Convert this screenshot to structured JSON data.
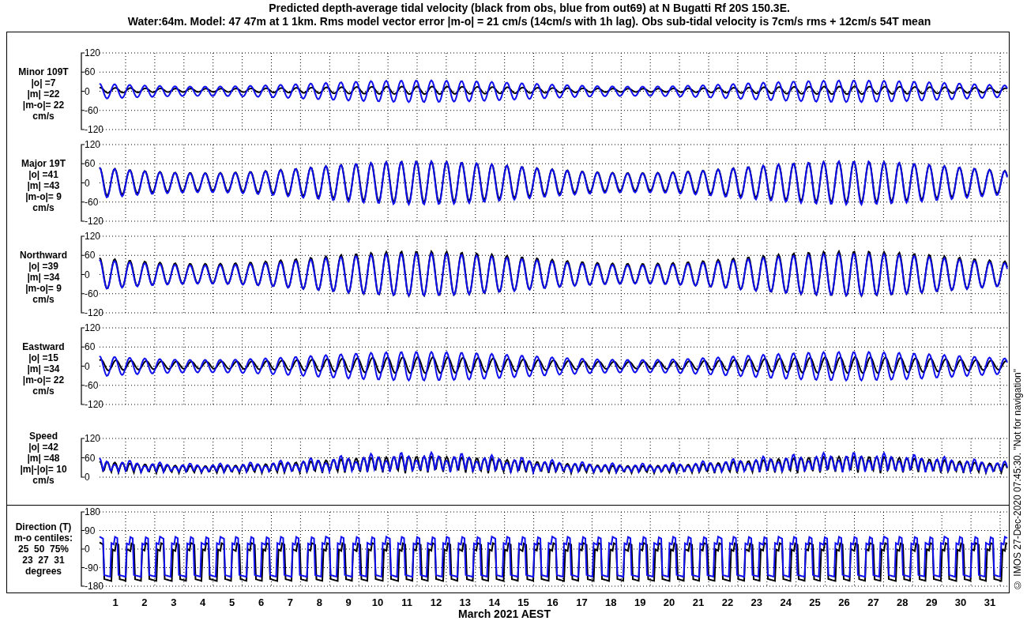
{
  "title_lines": [
    "Predicted depth-average tidal velocity (black from obs, blue from out69) at N Bugatti Rf 20S 150.3E.",
    "Water:64m. Model: 47 47m at 1 1km. Rms model vector error |m-o| = 21 cm/s (14cm/s with 1h lag). Obs sub-tidal velocity is 7cm/s rms + 12cm/s 54T mean"
  ],
  "panels": [
    {
      "kind": "velocity",
      "label_lines": [
        "Minor 109T",
        "|o| =7",
        "|m| =22",
        "|m-o|= 22",
        "cm/s"
      ],
      "yticks": [
        "120",
        "60",
        "0",
        "-60",
        "-120"
      ]
    },
    {
      "kind": "velocity",
      "label_lines": [
        "Major 19T",
        "|o| =41",
        "|m| =43",
        "|m-o|= 9",
        "cm/s"
      ],
      "yticks": [
        "120",
        "60",
        "0",
        "-60",
        "-120"
      ]
    },
    {
      "kind": "velocity",
      "label_lines": [
        "Northward",
        "|o| =39",
        "|m| =34",
        "|m-o|= 9",
        "cm/s"
      ],
      "yticks": [
        "120",
        "60",
        "0",
        "-60",
        "-120"
      ]
    },
    {
      "kind": "velocity",
      "label_lines": [
        "Eastward",
        "|o| =15",
        "|m| =34",
        "|m-o|= 22",
        "cm/s"
      ],
      "yticks": [
        "120",
        "60",
        "0",
        "-60",
        "-120"
      ]
    },
    {
      "kind": "speed",
      "label_lines": [
        "Speed",
        "|o| =42",
        "|m| =48",
        "|m|-|o|= 10",
        "cm/s"
      ],
      "yticks": [
        "120",
        "60",
        "0"
      ]
    },
    {
      "kind": "direction",
      "label_lines": [
        "Direction (T)",
        "m-o centiles:",
        "25  50  75%",
        "23  27  31",
        "degrees"
      ],
      "yticks": [
        "180",
        "90",
        "0",
        "-90",
        "-180"
      ]
    }
  ],
  "x_axis": {
    "day_labels": [
      "1",
      "2",
      "3",
      "4",
      "5",
      "6",
      "7",
      "8",
      "9",
      "10",
      "11",
      "12",
      "13",
      "14",
      "15",
      "16",
      "17",
      "18",
      "19",
      "20",
      "21",
      "22",
      "23",
      "24",
      "25",
      "26",
      "27",
      "28",
      "29",
      "30",
      "31"
    ],
    "label": "March 2021 AEST"
  },
  "side_note": "© IMOS 27-Dec-2020 07:45:30. \"Not for navigation\""
}
